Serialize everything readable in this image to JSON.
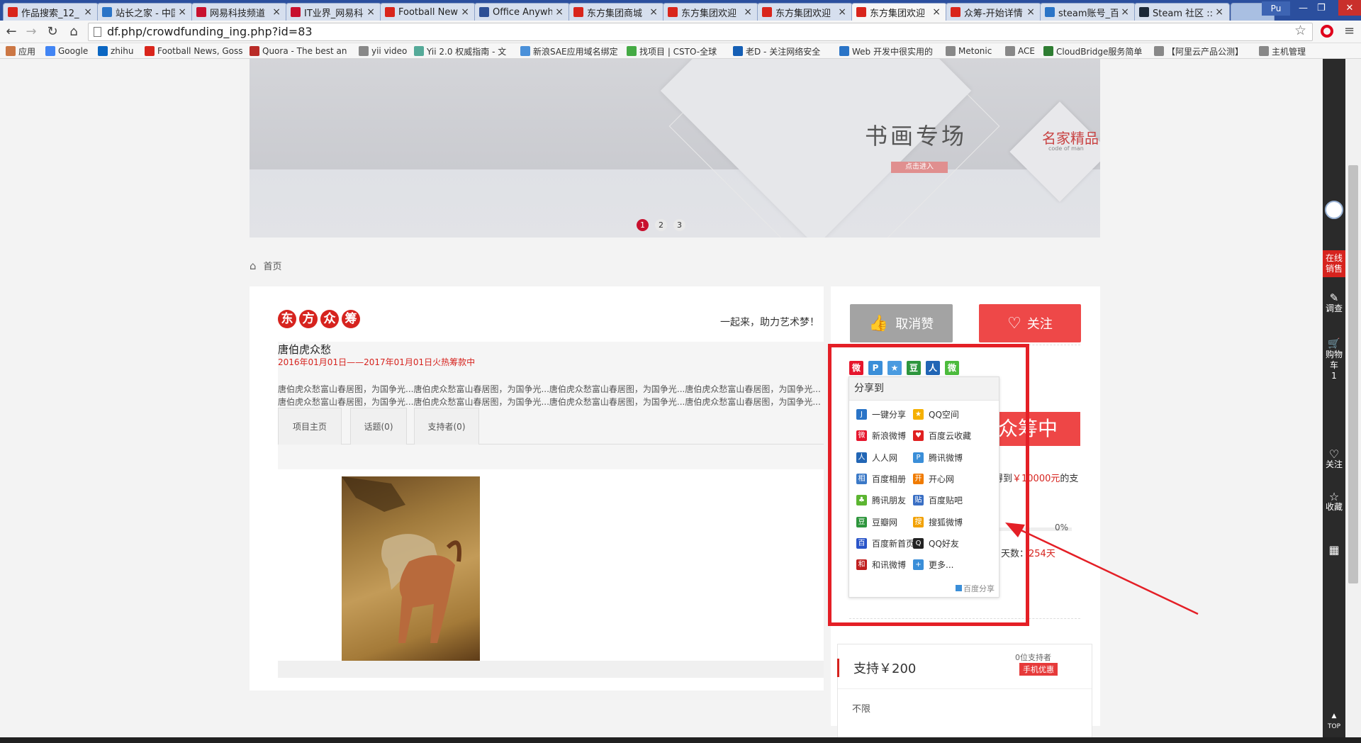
{
  "browser": {
    "tabs": [
      {
        "title": "作品搜索_12_",
        "color": "#d9251b"
      },
      {
        "title": "站长之家 - 中国",
        "color": "#2a74c7"
      },
      {
        "title": "网易科技频道",
        "color": "#c8102e"
      },
      {
        "title": "IT业界_网易科技",
        "color": "#c8102e"
      },
      {
        "title": "Football News",
        "color": "#d9251b"
      },
      {
        "title": "Office Anywhere",
        "color": "#2d4f95"
      },
      {
        "title": "东方集团商城",
        "color": "#d9251b"
      },
      {
        "title": "东方集团欢迎",
        "color": "#d9251b"
      },
      {
        "title": "东方集团欢迎",
        "color": "#d9251b"
      },
      {
        "title": "东方集团欢迎",
        "color": "#d9251b"
      },
      {
        "title": "众筹-开始详情",
        "color": "#d9251b"
      },
      {
        "title": "steam账号_百度",
        "color": "#2a74c7"
      },
      {
        "title": "Steam 社区 ::",
        "color": "#1b2838"
      }
    ],
    "profile": "Pu",
    "url": "df.php/crowdfunding_ing.php?id=83",
    "bookmarks": [
      "应用",
      "Google",
      "zhihu",
      "Football News, Goss",
      "Quora - The best an",
      "yii video",
      "Yii 2.0 权威指南 - 文",
      "新浪SAE应用域名绑定",
      "找项目 | CSTO-全球",
      "老D - 关注网络安全",
      "Web 开发中很实用的",
      "Metonic",
      "ACE",
      "CloudBridge服务简单",
      "【阿里云产品公测】",
      "主机管理"
    ]
  },
  "banner": {
    "title_text": "书画专场",
    "subtitle": "名家精品",
    "sub_en": "code of man",
    "enter": "点击进入",
    "dots": [
      "1",
      "2",
      "3"
    ]
  },
  "breadcrumb": {
    "home": "首页"
  },
  "project": {
    "logo": [
      "东",
      "方",
      "众",
      "筹"
    ],
    "slogan": "一起来，助力艺术梦！",
    "title": "唐伯虎众愁",
    "dates": "2016年01月01日——2017年01月01日火热筹款中",
    "desc": "唐伯虎众愁富山春居图，为国争光...唐伯虎众愁富山春居图，为国争光...唐伯虎众愁富山春居图，为国争光...唐伯虎众愁富山春居图，为国争光...唐伯虎众愁富山春居图，为国争光...唐伯虎众愁富山春居图，为国争光...唐伯虎众愁富山春居图，为国争光...唐伯虎众愁富山春居图，为国争光...",
    "tabs": [
      "项目主页",
      "话题(0)",
      "支持者(0)"
    ]
  },
  "actions": {
    "unlike": "取消赞",
    "follow": "关注"
  },
  "share": {
    "header": "分享到",
    "items": [
      {
        "label": "一键分享",
        "color": "#2a74c7",
        "glyph": "J"
      },
      {
        "label": "QQ空间",
        "color": "#f5b000",
        "glyph": "★"
      },
      {
        "label": "新浪微博",
        "color": "#e6162d",
        "glyph": "微"
      },
      {
        "label": "百度云收藏",
        "color": "#e02020",
        "glyph": "♥"
      },
      {
        "label": "人人网",
        "color": "#2266b5",
        "glyph": "人"
      },
      {
        "label": "腾讯微博",
        "color": "#3a8ed8",
        "glyph": "P"
      },
      {
        "label": "百度相册",
        "color": "#3b79c7",
        "glyph": "相"
      },
      {
        "label": "开心网",
        "color": "#f07b00",
        "glyph": "开"
      },
      {
        "label": "腾讯朋友",
        "color": "#5cb531",
        "glyph": "♣"
      },
      {
        "label": "百度贴吧",
        "color": "#3a6fc4",
        "glyph": "贴"
      },
      {
        "label": "豆瓣网",
        "color": "#2e963d",
        "glyph": "豆"
      },
      {
        "label": "搜狐微博",
        "color": "#f2a100",
        "glyph": "搜"
      },
      {
        "label": "百度新首页",
        "color": "#2a55c9",
        "glyph": "百"
      },
      {
        "label": "QQ好友",
        "color": "#222222",
        "glyph": "Q"
      },
      {
        "label": "和讯微博",
        "color": "#c01f1f",
        "glyph": "和"
      },
      {
        "label": "更多...",
        "color": "#3a8ed8",
        "glyph": "+"
      }
    ],
    "footer": "百度分享"
  },
  "status": {
    "crowd": "众筹中",
    "target_prefix": "得到",
    "target_amount": "￥10000元",
    "target_suffix": "的支",
    "percent": "0%",
    "days_label": "天数：",
    "days_value": "254天"
  },
  "support": {
    "title": "支持￥200",
    "supporters": "0位支持者",
    "badge": "手机优惠",
    "limit": "不限"
  },
  "rail": {
    "online": "在线销售",
    "survey": "调查",
    "cart": "购物车",
    "cart_count": "1",
    "follow": "关注",
    "collect": "收藏",
    "top": "TOP"
  }
}
